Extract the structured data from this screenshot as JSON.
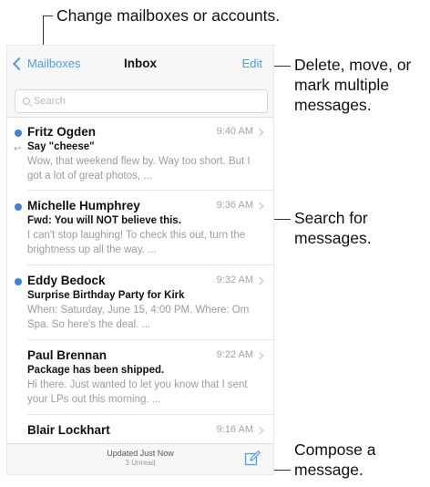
{
  "callouts": {
    "mailboxes": "Change mailboxes or accounts.",
    "edit": [
      "Delete, move, or",
      "mark multiple",
      "messages."
    ],
    "search": [
      "Search for",
      "messages."
    ],
    "compose": [
      "Compose a",
      "message."
    ]
  },
  "navbar": {
    "back_label": "Mailboxes",
    "title": "Inbox",
    "edit_label": "Edit"
  },
  "search": {
    "placeholder": "Search"
  },
  "messages": [
    {
      "sender": "Fritz Ogden",
      "time": "9:40 AM",
      "subject": "Say \"cheese\"",
      "preview": "Wow, that weekend flew by. Way too short. But I got a lot of great photos, ..."
    },
    {
      "sender": "Michelle Humphrey",
      "time": "9:36 AM",
      "subject": "Fwd: You will NOT believe this.",
      "preview": "I can't stop laughing! To check this out, turn the brightness up all the way. ..."
    },
    {
      "sender": "Eddy Bedock",
      "time": "9:32 AM",
      "subject": "Surprise Birthday Party for Kirk",
      "preview": "When: Saturday, June 15, 4:00 PM. Where: Om Spa. So here's the deal. ..."
    },
    {
      "sender": "Paul Brennan",
      "time": "9:22 AM",
      "subject": "Package has been shipped.",
      "preview": "Hi there. Just wanted to let you know that I sent your LPs out this morning. ..."
    },
    {
      "sender": "Blair Lockhart",
      "time": "9:16 AM",
      "subject": "",
      "preview": ""
    }
  ],
  "toolbar": {
    "status": "Updated Just Now",
    "unread": "3 Unread"
  },
  "colors": {
    "accent": "#4a9cf0",
    "unread_dot": "#3b82e0"
  },
  "icons": {
    "back": "chevron-left-icon",
    "search": "search-icon",
    "compose": "compose-icon",
    "disclosure": "chevron-right-icon",
    "replied": "reply-arrow-icon",
    "unread": "unread-dot-icon"
  }
}
